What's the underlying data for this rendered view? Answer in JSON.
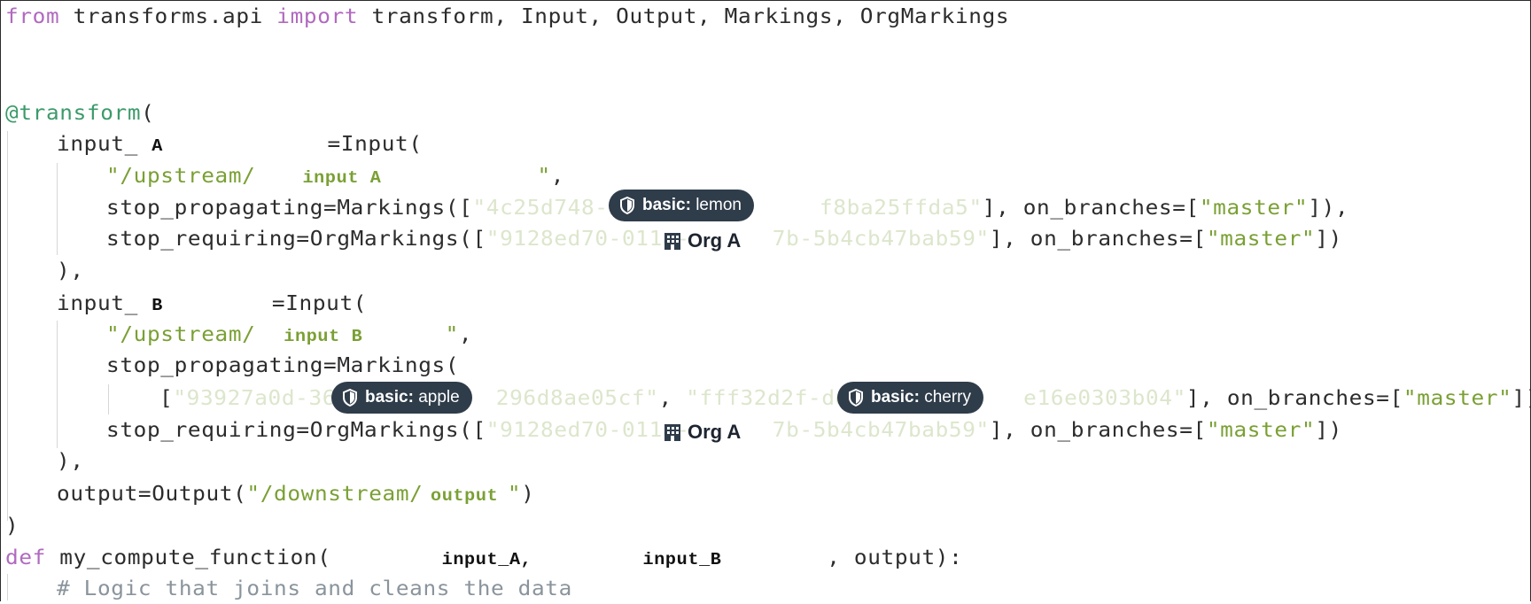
{
  "editor": {
    "lines": {
      "import": {
        "kw_from": "from",
        "module": " transforms.api ",
        "kw_import": "import",
        "names": " transform, Input, Output, Markings, OrgMarkings"
      },
      "decorator": {
        "name": "@transform",
        "paren": "("
      },
      "input_a_decl": {
        "prefix": "input_",
        "overlay": "A",
        "suffix": "=Input("
      },
      "input_a_path": {
        "open": "\"/upstream/",
        "overlay": "input A",
        "close": "\"",
        "comma": ","
      },
      "input_a_stop_prop": {
        "prefix": "stop_propagating=Markings([",
        "uuid_start": "\"4c25d748-b1",
        "uuid_end": "f8ba25ffda5\"",
        "suffix_a": "], on_branches=[",
        "branch": "\"master\"",
        "suffix_b": "]),"
      },
      "input_a_stop_req": {
        "prefix": "stop_requiring=OrgMarkings([",
        "uuid_start": "\"9128ed70-011a-",
        "uuid_end": "7b-5b4cb47bab59\"",
        "suffix_a": "], on_branches=[",
        "branch": "\"master\"",
        "suffix_b": "])"
      },
      "close_a": "),",
      "input_b_decl": {
        "prefix": "input_",
        "overlay": "B",
        "suffix": "=Input("
      },
      "input_b_path": {
        "open": "\"/upstream/",
        "overlay": "input B",
        "close": "\"",
        "comma": ","
      },
      "input_b_stop_prop": {
        "prefix": "stop_propagating=Markings("
      },
      "input_b_markings": {
        "open": "[",
        "uuid1_start": "\"93927a0d-360",
        "uuid1_end": "296d8ae05cf\"",
        "sep": ", ",
        "uuid2_start": "\"fff32d2f-dd",
        "uuid2_end": "e16e0303b04\"",
        "suffix_a": "], on_branches=[",
        "branch": "\"master\"",
        "suffix_b": "]),"
      },
      "input_b_stop_req": {
        "prefix": "stop_requiring=OrgMarkings([",
        "uuid_start": "\"9128ed70-011a-",
        "uuid_end": "7b-5b4cb47bab59\"",
        "suffix_a": "], on_branches=[",
        "branch": "\"master\"",
        "suffix_b": "])"
      },
      "close_b": "),",
      "output": {
        "prefix": "output=Output(",
        "open": "\"/downstream/",
        "overlay": "output",
        "close": "\"",
        "suffix": ")"
      },
      "close_decorator": ")",
      "def": {
        "kw": "def",
        "name": " my_compute_function(",
        "arg_a": "input_A,",
        "arg_b": "input_B",
        "rest": ", output):"
      },
      "comment": "# Logic that joins and cleans the data"
    },
    "badges": [
      {
        "prefix": "basic:",
        "value": "lemon",
        "icon": "shield-icon"
      },
      {
        "prefix": "basic:",
        "value": "apple",
        "icon": "shield-icon"
      },
      {
        "prefix": "basic:",
        "value": "cherry",
        "icon": "shield-icon"
      }
    ],
    "org_labels": [
      {
        "label": "Org A",
        "icon": "building-icon"
      },
      {
        "label": "Org A",
        "icon": "building-icon"
      }
    ]
  }
}
